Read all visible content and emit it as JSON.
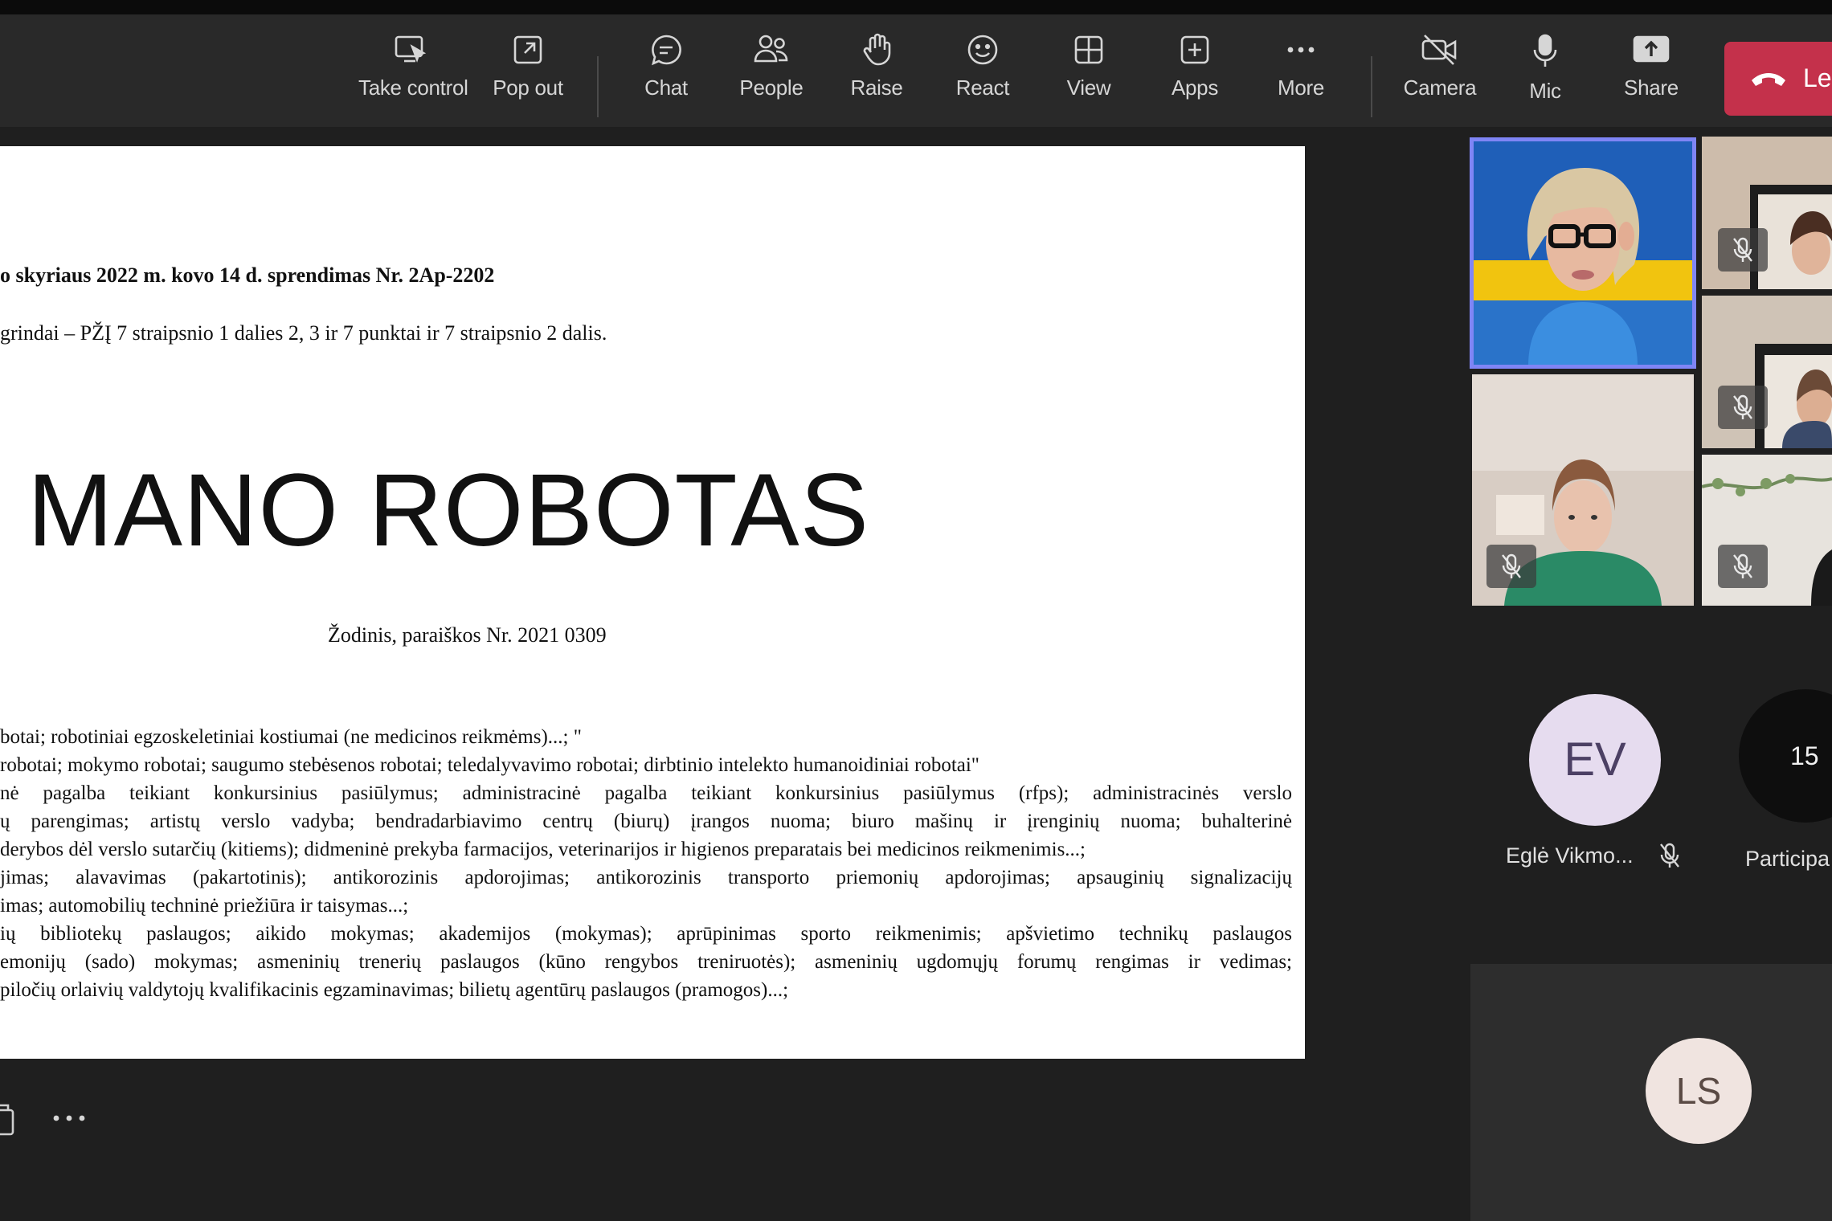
{
  "toolbar": {
    "take_control": "Take control",
    "pop_out": "Pop out",
    "chat": "Chat",
    "people": "People",
    "raise": "Raise",
    "react": "React",
    "view": "View",
    "apps": "Apps",
    "more": "More",
    "camera": "Camera",
    "mic": "Mic",
    "share": "Share",
    "leave": "Le"
  },
  "document": {
    "heading_line": "o skyriaus 2022 m. kovo 14 d. sprendimas Nr. 2Ap-2202",
    "grounds_line": "grindai – PŽĮ 7 straipsnio 1 dalies 2, 3 ir 7 punktai ir 7 straipsnio 2 dalis.",
    "mark_title": "MANO ROBOTAS",
    "mark_caption": "Žodinis, paraiškos Nr. 2021 0309",
    "para1": [
      "botai; robotiniai egzoskeletiniai kostiumai (ne medicinos reikmėms)...; \""
    ],
    "para2": [
      "robotai; mokymo robotai; saugumo stebėsenos robotai; teledalyvavimo robotai; dirbtinio intelekto humanoidiniai robotai\""
    ],
    "para3": [
      "nė pagalba teikiant konkursinius pasiūlymus; administracinė pagalba teikiant konkursinius pasiūlymus (rfps); administracinės verslo",
      "ų parengimas; artistų verslo vadyba; bendradarbiavimo centrų (biurų) įrangos nuoma; biuro mašinų ir įrenginių nuoma; buhalterinė",
      "derybos dėl verslo sutarčių (kitiems); didmeninė prekyba farmacijos, veterinarijos ir higienos preparatais bei medicinos reikmenimis...;"
    ],
    "para4": [
      "jimas; alavavimas (pakartotinis); antikorozinis apdorojimas; antikorozinis transporto priemonių apdorojimas; apsauginių signalizacijų",
      "imas; automobilių techninė priežiūra ir taisymas...;"
    ],
    "para5": [
      "ių bibliotekų paslaugos; aikido mokymas; akademijos (mokymas); aprūpinimas sporto reikmenimis; apšvietimo technikų paslaugos",
      "emonijų (sado) mokymas; asmeninių trenerių paslaugos (kūno rengybos treniruotės); asmeninių ugdomųjų forumų rengimas ir vedimas;",
      "piločių orlaivių valdytojų kvalifikacinis egzaminavimas; bilietų agentūrų paslaugos (pramogos)...;"
    ]
  },
  "participants": {
    "ev_initials": "EV",
    "ev_name": "Eglė Vikmo...",
    "overflow_count": "15",
    "overflow_label": "Participa",
    "ls_initials": "LS"
  },
  "colors": {
    "accent": "#7f85f5",
    "leave": "#c4314b"
  }
}
